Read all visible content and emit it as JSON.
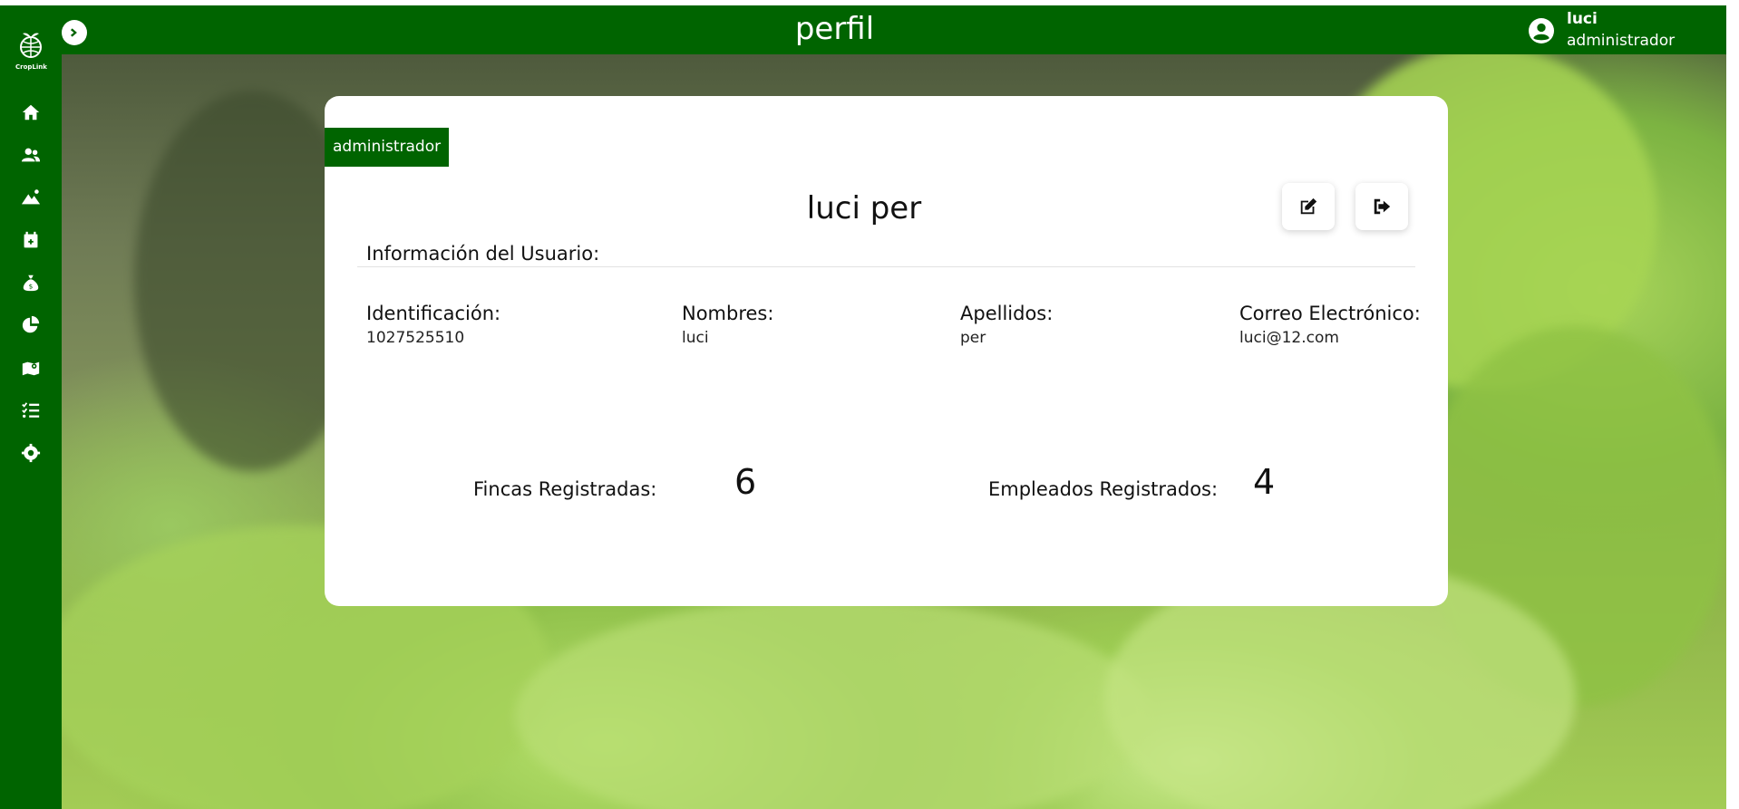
{
  "app": {
    "logo_text": "CropLink"
  },
  "header": {
    "title": "perfil",
    "user_name": "luci",
    "user_role": "administrador"
  },
  "sidebar": {
    "items": [
      {
        "icon": "home-icon"
      },
      {
        "icon": "users-icon"
      },
      {
        "icon": "mountain-icon"
      },
      {
        "icon": "calendar-plus-icon"
      },
      {
        "icon": "money-bag-icon"
      },
      {
        "icon": "pie-chart-icon"
      },
      {
        "icon": "map-icon"
      },
      {
        "icon": "task-list-icon"
      },
      {
        "icon": "gear-icon"
      }
    ]
  },
  "profile": {
    "role_tag": "administrador",
    "full_name": "luci per",
    "section_title": "Información del Usuario:",
    "fields": [
      {
        "label": "Identificación:",
        "value": "1027525510"
      },
      {
        "label": "Nombres:",
        "value": "luci"
      },
      {
        "label": "Apellidos:",
        "value": "per"
      },
      {
        "label": "Correo Electrónico:",
        "value": "luci@12.com"
      }
    ],
    "stats": [
      {
        "label": "Fincas Registradas:",
        "value": "6"
      },
      {
        "label": "Empleados Registrados:",
        "value": "4"
      }
    ],
    "actions": [
      {
        "icon": "edit-icon"
      },
      {
        "icon": "logout-icon"
      }
    ]
  },
  "colors": {
    "primary": "#006400",
    "card": "#ffffff",
    "text": "#111111"
  }
}
